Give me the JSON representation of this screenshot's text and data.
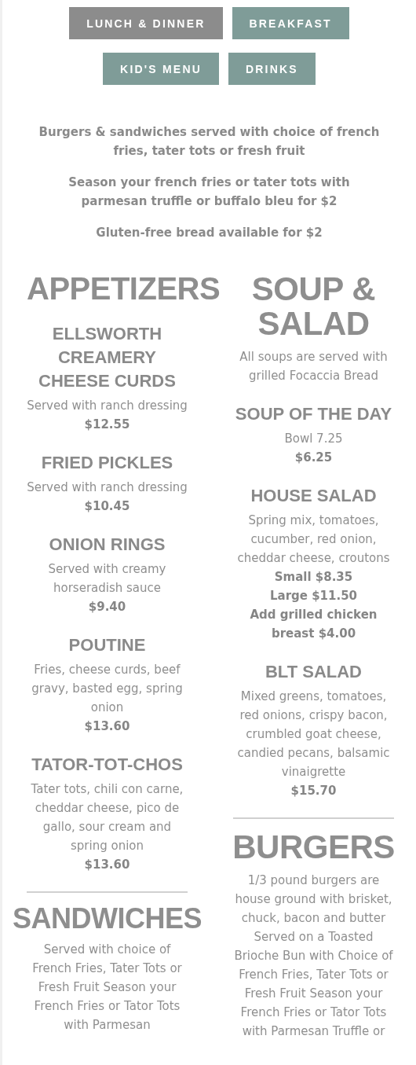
{
  "tabs": [
    {
      "label": "LUNCH & DINNER",
      "selected": true
    },
    {
      "label": "BREAKFAST",
      "selected": false
    },
    {
      "label": "KID'S MENU",
      "selected": false
    },
    {
      "label": "DRINKS",
      "selected": false
    }
  ],
  "notes": [
    "Burgers & sandwiches served with choice of french fries, tater tots or fresh fruit",
    "Season your french fries or tater tots with parmesan truffle or buffalo bleu for $2",
    "Gluten-free bread available for $2"
  ],
  "columns": [
    {
      "sections": [
        {
          "title": "APPETIZERS",
          "divider": false,
          "items": [
            {
              "name": "ELLSWORTH CREAMERY CHEESE CURDS",
              "description": "Served with ranch dressing",
              "prices": [
                "$12.55"
              ]
            },
            {
              "name": "FRIED PICKLES",
              "description": "Served with ranch dressing",
              "prices": [
                "$10.45"
              ]
            },
            {
              "name": "ONION RINGS",
              "description": "Served with creamy horseradish sauce",
              "prices": [
                "$9.40"
              ]
            },
            {
              "name": "POUTINE",
              "description": "Fries, cheese curds, beef gravy, basted egg, spring onion",
              "prices": [
                "$13.60"
              ]
            },
            {
              "name": "TATOR-TOT-CHOS",
              "description": "Tater tots, chili con carne, cheddar cheese, pico de gallo, sour cream and spring onion",
              "prices": [
                "$13.60"
              ]
            }
          ]
        },
        {
          "title": "SANDWICHES",
          "divider": true,
          "description": "Served with choice of French Fries, Tater Tots or Fresh Fruit Season your French Fries or Tator Tots with Parmesan"
        }
      ]
    },
    {
      "sections": [
        {
          "title": "SOUP & SALAD",
          "divider": false,
          "description": "All soups are served with grilled Focaccia Bread",
          "items": [
            {
              "name": "SOUP OF THE DAY",
              "description": "Bowl 7.25",
              "prices": [
                "$6.25"
              ]
            },
            {
              "name": "HOUSE SALAD",
              "description": "Spring mix, tomatoes, cucumber, red onion, cheddar cheese, croutons",
              "prices": [
                "Small $8.35",
                "Large $11.50",
                "Add grilled chicken breast $4.00"
              ]
            },
            {
              "name": "BLT SALAD",
              "description": "Mixed greens, tomatoes, red onions, crispy bacon, crumbled goat cheese, candied pecans, balsamic vinaigrette",
              "prices": [
                "$15.70"
              ]
            }
          ]
        },
        {
          "title": "BURGERS",
          "divider": true,
          "description": "1/3 pound burgers are house ground with brisket, chuck, bacon and butter Served on a Toasted Brioche Bun with Choice of French Fries, Tater Tots or Fresh Fruit Season your French Fries or Tator Tots with Parmesan Truffle or"
        }
      ]
    }
  ]
}
